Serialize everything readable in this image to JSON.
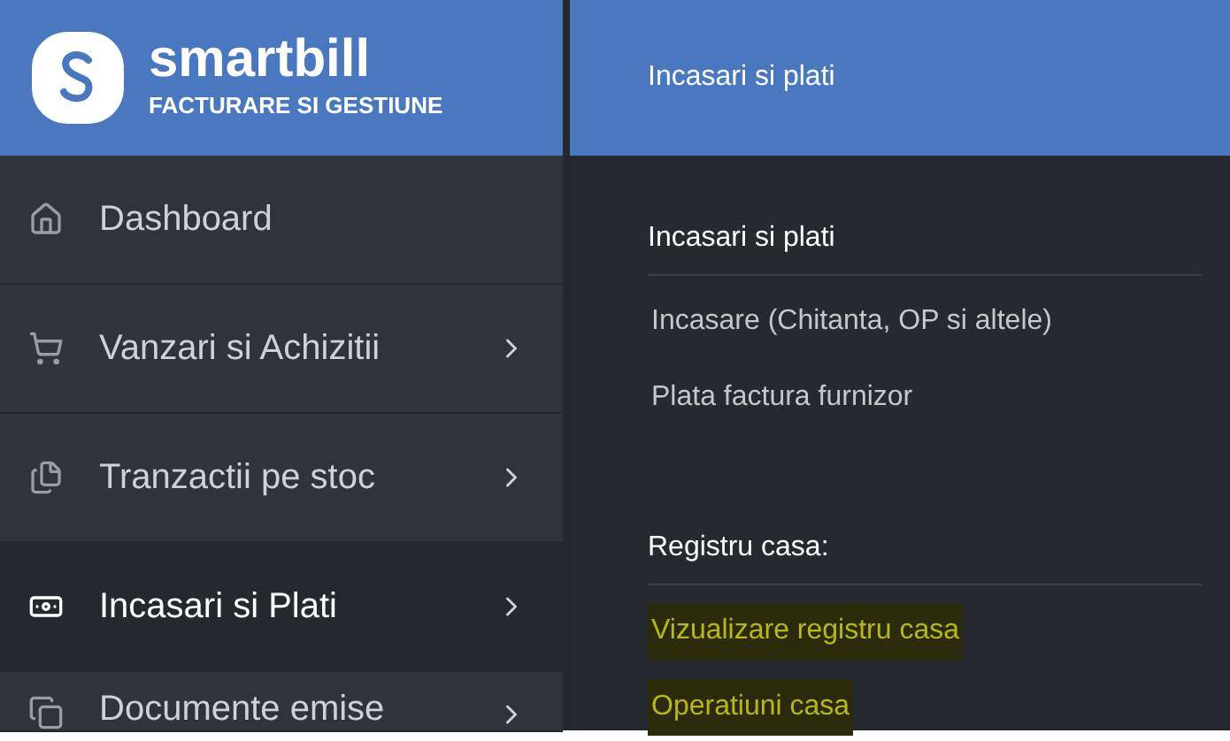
{
  "logo": {
    "name": "smartbill",
    "tagline": "FACTURARE SI GESTIUNE"
  },
  "sidebar": {
    "items": [
      {
        "label": "Dashboard",
        "kind": "home",
        "selected": false,
        "submenu": false
      },
      {
        "label": "Vanzari si Achizitii",
        "kind": "cart",
        "selected": false,
        "submenu": true
      },
      {
        "label": "Tranzactii pe stoc",
        "kind": "files",
        "selected": false,
        "submenu": true
      },
      {
        "label": "Incasari si Plati",
        "kind": "money",
        "selected": true,
        "submenu": true
      },
      {
        "label": "Documente emise",
        "kind": "docs",
        "selected": false,
        "submenu": true
      }
    ]
  },
  "panel": {
    "title": "Incasari si plati",
    "sections": [
      {
        "title": "Incasari si plati",
        "links": [
          {
            "label": "Incasare (Chitanta, OP si altele)",
            "highlighted": false
          },
          {
            "label": "Plata factura furnizor",
            "highlighted": false
          }
        ]
      },
      {
        "title": "Registru casa:",
        "links": [
          {
            "label": "Vizualizare registru casa",
            "highlighted": true
          },
          {
            "label": "Operatiuni casa",
            "highlighted": true
          }
        ]
      }
    ]
  }
}
